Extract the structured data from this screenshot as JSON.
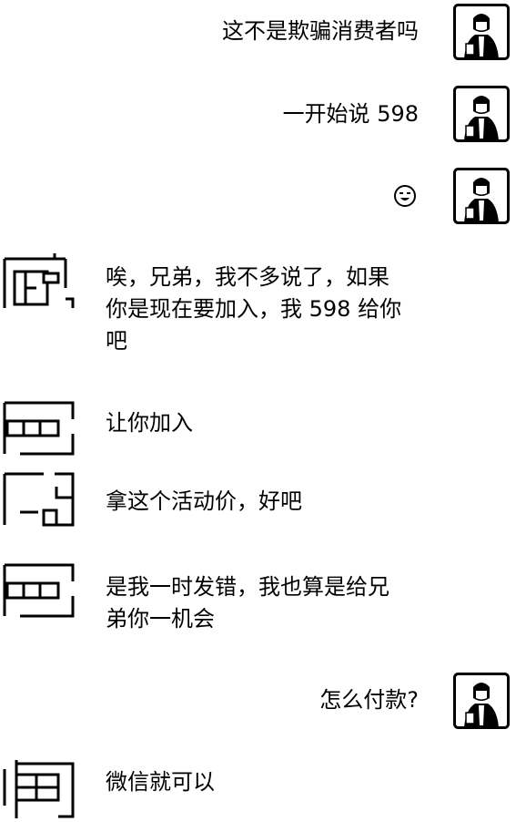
{
  "chat": {
    "messages": [
      {
        "side": "right",
        "text": "这不是欺骗消费者吗"
      },
      {
        "side": "right",
        "text": "一开始说 598"
      },
      {
        "side": "right",
        "text": "",
        "icon": "smiley-face-icon"
      },
      {
        "side": "left",
        "lines": [
          "唉，兄弟，我不多说了，如果",
          "你是现在要加入，我 598 给你",
          "吧"
        ]
      },
      {
        "side": "left",
        "text": "让你加入"
      },
      {
        "side": "left",
        "text": "拿这个活动价，好吧"
      },
      {
        "side": "left",
        "lines": [
          "是我一时发错，我也算是给兄",
          "弟你一机会"
        ]
      },
      {
        "side": "right",
        "text": "怎么付款?"
      },
      {
        "side": "left",
        "text": "微信就可以"
      }
    ]
  },
  "icons": {
    "user_avatar": "user-avatar-icon",
    "contact_avatar": "contact-avatar-icon",
    "emoji": "smiley-face-icon"
  },
  "colors": {
    "background": "#ffffff",
    "text": "#000000"
  }
}
